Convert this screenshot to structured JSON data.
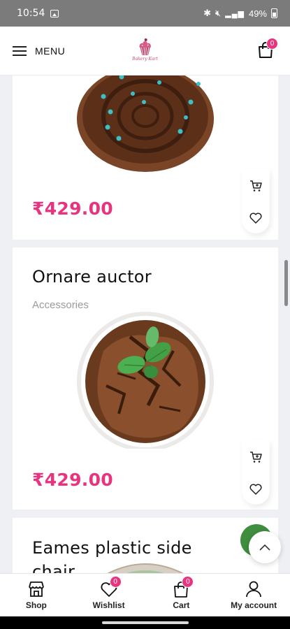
{
  "status": {
    "time": "10:54",
    "battery": "49%"
  },
  "header": {
    "menu_label": "MENU",
    "logo_text": "Bakery Kart",
    "cart_count": "0"
  },
  "products": [
    {
      "name": "",
      "category": "",
      "price": "₹429.00"
    },
    {
      "name": "Ornare auctor",
      "category": "Accessories",
      "price": "₹429.00"
    },
    {
      "name": "Eames plastic side chair",
      "category": "",
      "price": ""
    }
  ],
  "bottom_nav": [
    {
      "label": "Shop",
      "icon": "shop-icon"
    },
    {
      "label": "Wishlist",
      "icon": "heart-icon",
      "count": "0"
    },
    {
      "label": "Cart",
      "icon": "cart-bag-icon",
      "count": "0"
    },
    {
      "label": "My account",
      "icon": "user-icon"
    }
  ],
  "colors": {
    "accent": "#e8347e",
    "chat": "#3f8d3e",
    "statusbar": "#7b7b7b"
  }
}
